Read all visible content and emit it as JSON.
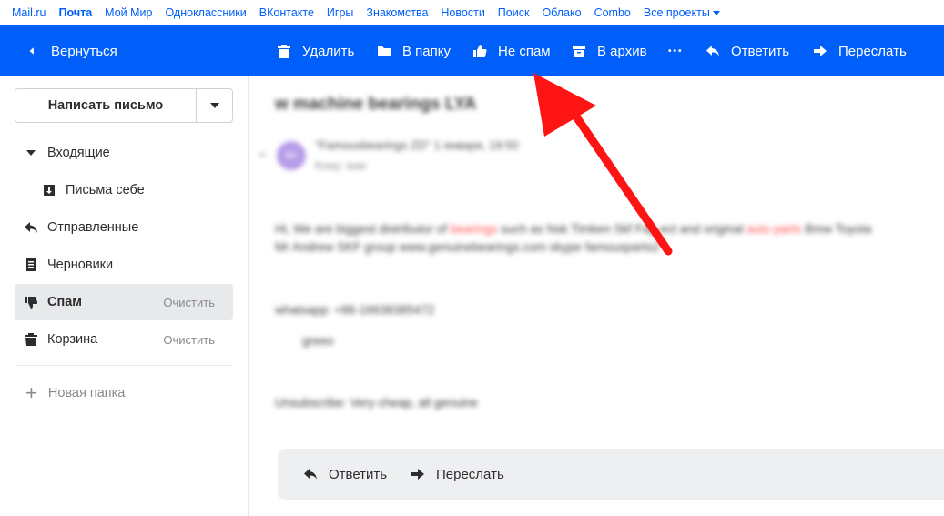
{
  "portal": {
    "links": [
      "Mail.ru",
      "Почта",
      "Мой Мир",
      "Одноклассники",
      "ВКонтакте",
      "Игры",
      "Знакомства",
      "Новости",
      "Поиск",
      "Облако",
      "Combo",
      "Все проекты"
    ]
  },
  "toolbar": {
    "back": "Вернуться",
    "delete": "Удалить",
    "to_folder": "В папку",
    "not_spam": "Не спам",
    "archive": "В архив",
    "more": "•••",
    "reply": "Ответить",
    "forward": "Переслать"
  },
  "sidebar": {
    "compose": "Написать письмо",
    "inbox": "Входящие",
    "self": "Письма себе",
    "sent": "Отправленные",
    "drafts": "Черновики",
    "spam": "Спам",
    "spam_clear": "Очистить",
    "trash": "Корзина",
    "trash_clear": "Очистить",
    "new_folder": "Новая папка"
  },
  "email": {
    "subject": "w machine bearings LYA",
    "avatar": "BK",
    "sender": "\"Famousbearings ZD\" 1 января, 19:50",
    "sender_sub": "Кому: вам",
    "line1_a": "Hi, We are biggest distributor of ",
    "line1_red1": "bearings",
    "line1_b": " such as Nsk Timken Skf Fag ect and original ",
    "line1_red2": "auto parts",
    "line1_c": " Bmw Toyota",
    "line2": "Mr Andrew SKF group www.genuinebearings.com skype famousparts2",
    "line3": "whatsapp: +86-16638385472",
    "line4": "greeo",
    "line5": "Unsubscribe: Very cheap, all genuine"
  },
  "reply_bar": {
    "reply": "Ответить",
    "forward": "Переслать"
  }
}
